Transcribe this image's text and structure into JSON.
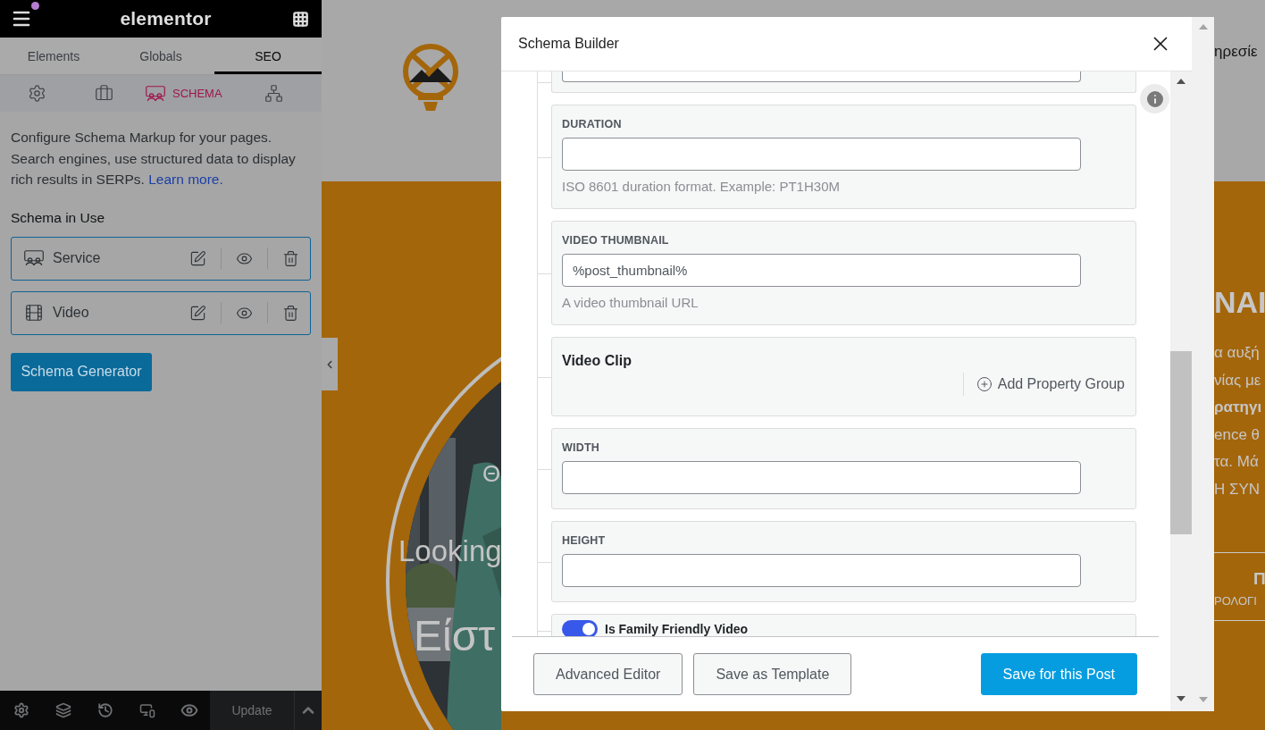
{
  "editor": {
    "logo": "elementor"
  },
  "panel_tabs": [
    {
      "label": "Elements",
      "selected": false
    },
    {
      "label": "Globals",
      "selected": false
    },
    {
      "label": "SEO",
      "selected": true
    }
  ],
  "seo_tabs": [
    {
      "kind": "settings",
      "selected": false
    },
    {
      "kind": "social",
      "selected": false
    },
    {
      "kind": "schema",
      "label": "SCHEMA",
      "selected": true
    },
    {
      "kind": "network",
      "selected": false
    }
  ],
  "description": "Configure Schema Markup for your pages. Search engines, use structured data to display rich results in SERPs.",
  "learn_more": "Learn more.",
  "schema_heading": "Schema in Use",
  "schemas": [
    {
      "kind": "service",
      "name": "Service"
    },
    {
      "kind": "video",
      "name": "Video"
    }
  ],
  "generator_button": "Schema Generator",
  "update_button": "Update",
  "preview": {
    "header_text": "ηρεσίε",
    "hero_texts": [
      "Θ",
      "Looking",
      "Είστ"
    ],
    "side_heading": "NAI",
    "side_lines": [
      {
        "text": "α αυξή",
        "bold": false
      },
      {
        "text": "νίας με",
        "bold": false
      },
      {
        "text": "ρατηγι",
        "bold": true
      },
      {
        "text": "ence θ",
        "bold": false
      },
      {
        "text": "τα. Μά",
        "bold": false
      },
      {
        "text": "Η ΣΥΝ",
        "bold": false
      }
    ],
    "side_title": "Π",
    "side_subtitle": "ΡΟΛΟΓΙ"
  },
  "modal": {
    "title": "Schema Builder",
    "properties": [
      {
        "kind": "cut_field"
      },
      {
        "kind": "text",
        "label": "DURATION",
        "help": "ISO 8601 duration format. Example: PT1H30M"
      },
      {
        "kind": "text",
        "label": "VIDEO THUMBNAIL",
        "value": "%post_thumbnail%",
        "help": "A video thumbnail URL"
      },
      {
        "kind": "group",
        "title": "Video Clip",
        "action": "Add Property Group"
      },
      {
        "kind": "text",
        "label": "WIDTH"
      },
      {
        "kind": "text",
        "label": "HEIGHT"
      },
      {
        "kind": "toggle",
        "label": "Is Family Friendly Video",
        "on": true
      }
    ],
    "buttons": [
      {
        "kind": "secondary",
        "label": "Advanced Editor"
      },
      {
        "kind": "secondary",
        "label": "Save as Template"
      },
      {
        "kind": "primary",
        "label": "Save for this Post"
      }
    ]
  }
}
